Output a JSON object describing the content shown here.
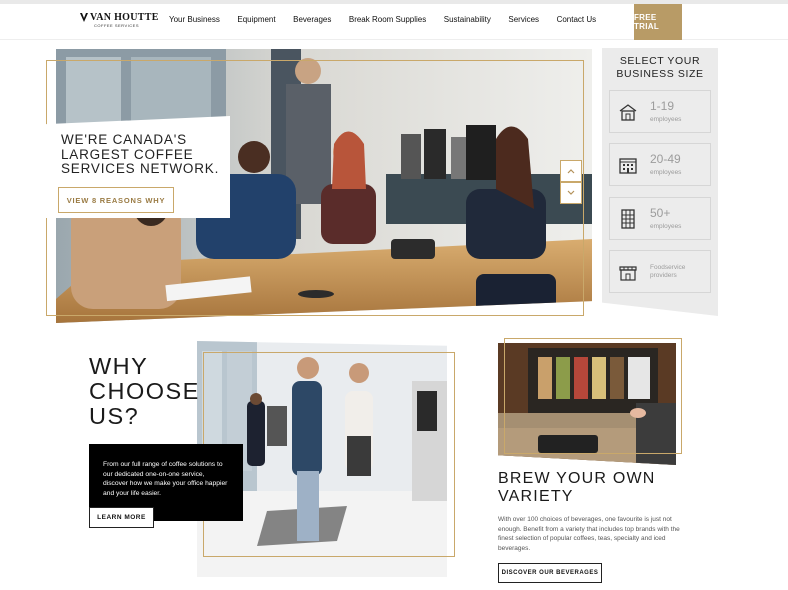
{
  "brand": {
    "name": "VAN HOUTTE",
    "tagline": "COFFEE SERVICES"
  },
  "nav": {
    "links": [
      "Your Business",
      "Equipment",
      "Beverages",
      "Break Room Supplies",
      "Sustainability",
      "Services",
      "Contact Us"
    ],
    "free_trial": "FREE TRIAL"
  },
  "hero": {
    "title": "WE'RE CANADA'S LARGEST COFFEE SERVICES NETWORK.",
    "button": "VIEW 8 REASONS WHY",
    "up_icon": "chevron-up-icon",
    "down_icon": "chevron-down-icon"
  },
  "business_size": {
    "title": "SELECT YOUR BUSINESS SIZE",
    "options": [
      {
        "value": "1-19",
        "label": "employees",
        "icon": "house-icon"
      },
      {
        "value": "20-49",
        "label": "employees",
        "icon": "building-icon"
      },
      {
        "value": "50+",
        "label": "employees",
        "icon": "tower-icon"
      },
      {
        "value": "",
        "label": "Foodservice providers",
        "icon": "storefront-icon"
      }
    ]
  },
  "why": {
    "title": "WHY CHOOSE US?",
    "text": "From our full range of coffee solutions to our dedicated one-on-one service, discover how we make your office happier and your life easier.",
    "button": "LEARN MORE"
  },
  "brew": {
    "title": "BREW YOUR OWN VARIETY",
    "text": "With over 100 choices of beverages, one favourite is just not enough. Benefit from a variety that includes top brands with the finest selection of popular coffees, teas, specialty and iced beverages.",
    "button": "DISCOVER OUR BEVERAGES"
  },
  "colors": {
    "accent_gold": "#c9a86a",
    "free_trial_bg": "#b89b66",
    "panel_gray": "#ebebeb"
  }
}
